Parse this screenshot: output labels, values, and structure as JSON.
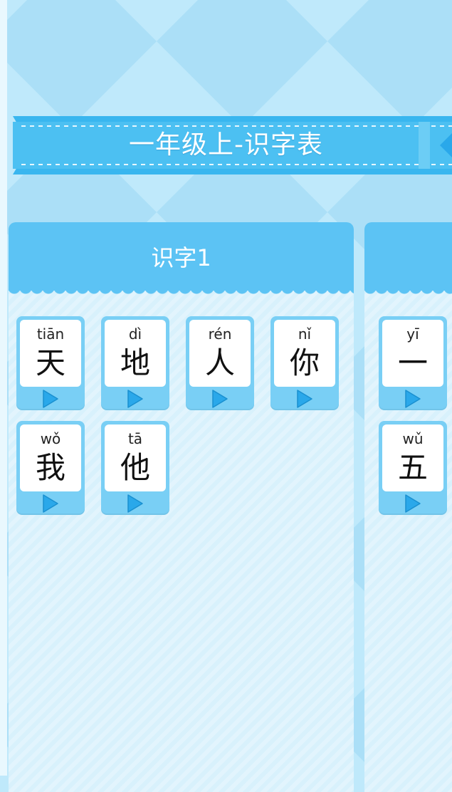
{
  "banner": {
    "title": "一年级上-识字表"
  },
  "panels": [
    {
      "title": "识字1",
      "cards": [
        {
          "pinyin": "tiān",
          "hanzi": "天"
        },
        {
          "pinyin": "dì",
          "hanzi": "地"
        },
        {
          "pinyin": "rén",
          "hanzi": "人"
        },
        {
          "pinyin": "nǐ",
          "hanzi": "你"
        },
        {
          "pinyin": "wǒ",
          "hanzi": "我"
        },
        {
          "pinyin": "tā",
          "hanzi": "他"
        }
      ]
    },
    {
      "title": "",
      "cards": [
        {
          "pinyin": "yī",
          "hanzi": "一"
        },
        {
          "pinyin": "wǔ",
          "hanzi": "五"
        }
      ]
    }
  ],
  "icons": {
    "play": "play-icon"
  },
  "colors": {
    "background": "#bfe9fb",
    "accent": "#5cc3f4",
    "card": "#79cff5",
    "play": "#2aa8ea"
  }
}
